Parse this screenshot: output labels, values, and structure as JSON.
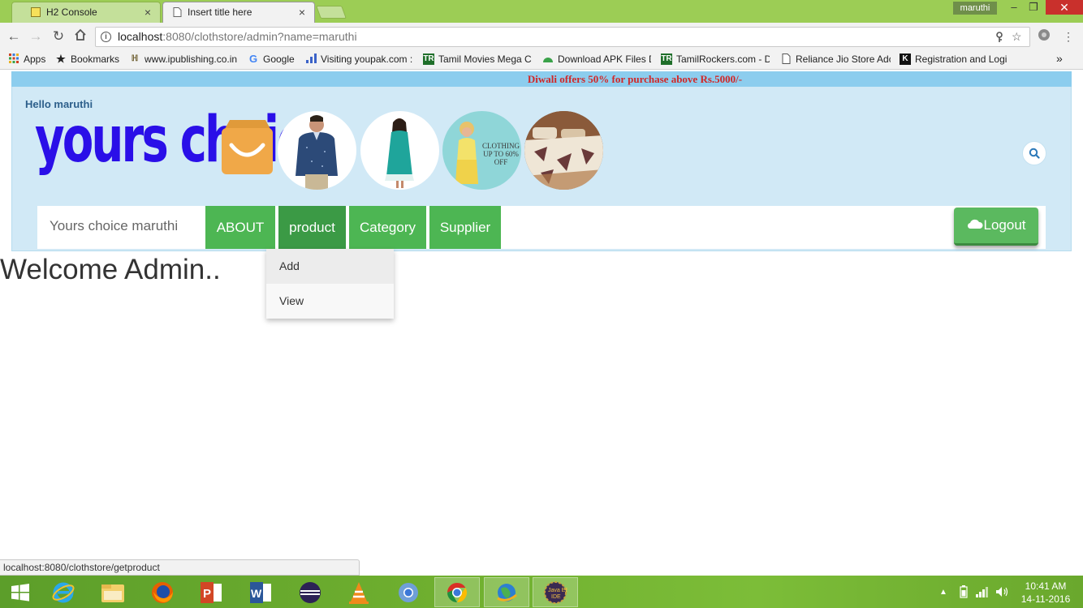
{
  "browser": {
    "tabs": [
      {
        "label": "H2 Console",
        "close": "×"
      },
      {
        "label": "Insert title here",
        "close": "×"
      }
    ],
    "profile_name": "maruthi",
    "window_controls": {
      "minimize": "–",
      "restore": "❐",
      "close": "✕"
    },
    "address": {
      "host": "localhost",
      "path": ":8080/clothstore/admin?name=maruthi"
    },
    "bookmarks": [
      {
        "label": "Apps",
        "icon": "apps-grid-icon"
      },
      {
        "label": "Bookmarks",
        "icon": "star-icon"
      },
      {
        "label": "www.ipublishing.co.in",
        "icon": "ipublishing-icon"
      },
      {
        "label": "Google",
        "icon": "google-icon"
      },
      {
        "label": "Visiting youpak.com :",
        "icon": "bars-icon"
      },
      {
        "label": "Tamil Movies Mega C",
        "icon": "tr-icon"
      },
      {
        "label": "Download APK Files D",
        "icon": "android-icon"
      },
      {
        "label": "TamilRockers.com - D",
        "icon": "tr-icon"
      },
      {
        "label": "Reliance Jio Store Adc",
        "icon": "page-icon"
      },
      {
        "label": "Registration and Logi",
        "icon": "k-icon"
      }
    ],
    "bookmarks_overflow": "»",
    "status_url": "localhost:8080/clothstore/getproduct"
  },
  "page": {
    "promo": "Diwali offers 50% for purchase above Rs.5000/-",
    "greeting": "Hello maruthi",
    "logo_text": "yours choice",
    "circle_caption": "CLOTHING UP TO 60% OFF",
    "nav": {
      "brand": "Yours choice maruthi",
      "items": [
        "ABOUT",
        "product",
        "Category",
        "Supplier"
      ],
      "logout": "Logout"
    },
    "dropdown": [
      "Add",
      "View"
    ],
    "welcome": "Welcome Admin.."
  },
  "taskbar": {
    "clock_time": "10:41 AM",
    "clock_date": "14-11-2016"
  },
  "colors": {
    "nav_green": "#4db653",
    "nav_green_active": "#3b9a45",
    "promo_bg": "#8ccdee",
    "header_bg": "#d1e9f6",
    "logo_blue": "#2a0fe8",
    "promo_text": "#d12727"
  }
}
